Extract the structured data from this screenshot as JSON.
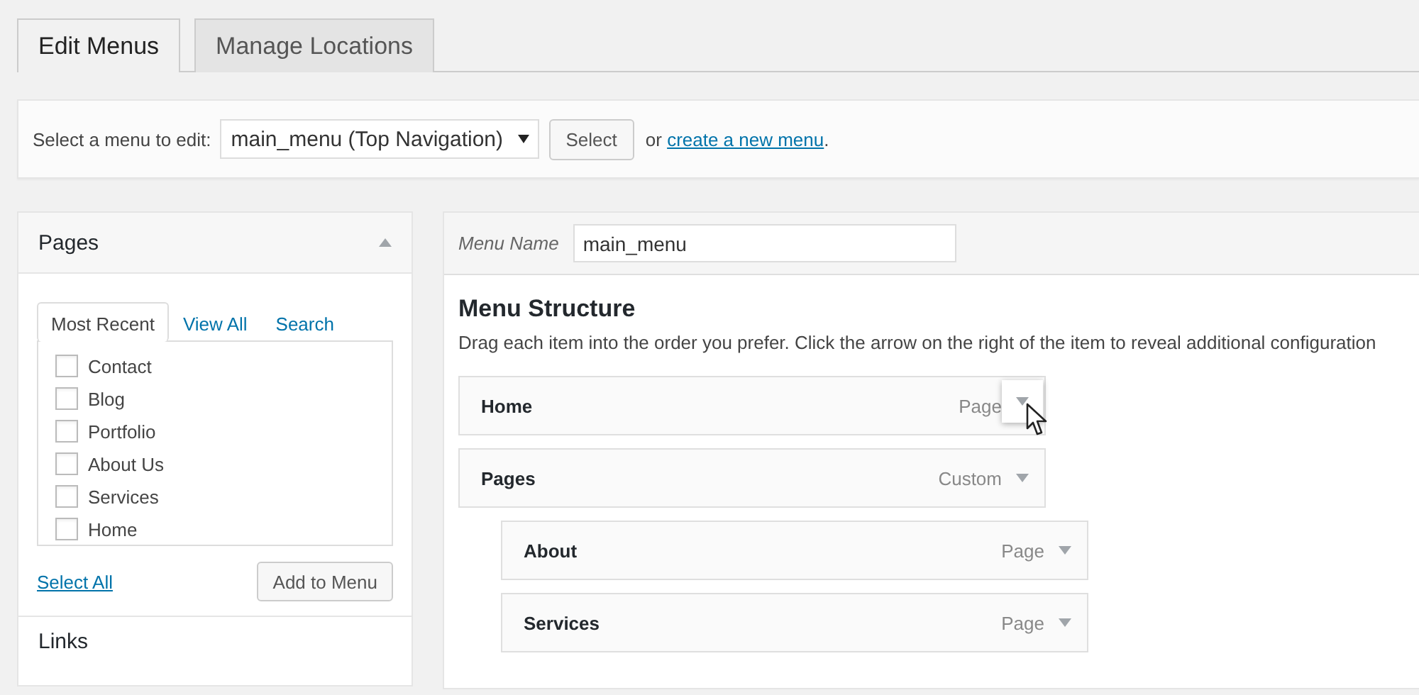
{
  "tabs": [
    {
      "label": "Edit Menus",
      "selected": true
    },
    {
      "label": "Manage Locations",
      "selected": false
    }
  ],
  "menu_select": {
    "label": "Select a menu to edit:",
    "value": "main_menu (Top Navigation)",
    "button": "Select",
    "prefix": "or",
    "link": "create a new menu",
    "suffix": "."
  },
  "pages_box": {
    "title": "Pages",
    "expanded": true,
    "tabs": [
      {
        "label": "Most Recent",
        "selected": true
      },
      {
        "label": "View All",
        "selected": false
      },
      {
        "label": "Search",
        "selected": false
      }
    ],
    "items": [
      {
        "label": "Contact",
        "checked": false
      },
      {
        "label": "Blog",
        "checked": false
      },
      {
        "label": "Portfolio",
        "checked": false
      },
      {
        "label": "About Us",
        "checked": false
      },
      {
        "label": "Services",
        "checked": false
      },
      {
        "label": "Home",
        "checked": false
      }
    ],
    "select_all": "Select All",
    "add_button": "Add to Menu"
  },
  "links_box": {
    "title": "Links"
  },
  "menu_editor": {
    "name_label": "Menu Name",
    "name_value": "main_menu",
    "heading": "Menu Structure",
    "description": "Drag each item into the order you prefer. Click the arrow on the right of the item to reveal additional configuration",
    "items": [
      {
        "title": "Home",
        "type": "Page",
        "hovered": true
      },
      {
        "title": "Pages",
        "type": "Custom",
        "hovered": false,
        "children": [
          {
            "title": "About",
            "type": "Page",
            "hovered": false
          },
          {
            "title": "Services",
            "type": "Page",
            "hovered": false
          }
        ]
      }
    ]
  }
}
